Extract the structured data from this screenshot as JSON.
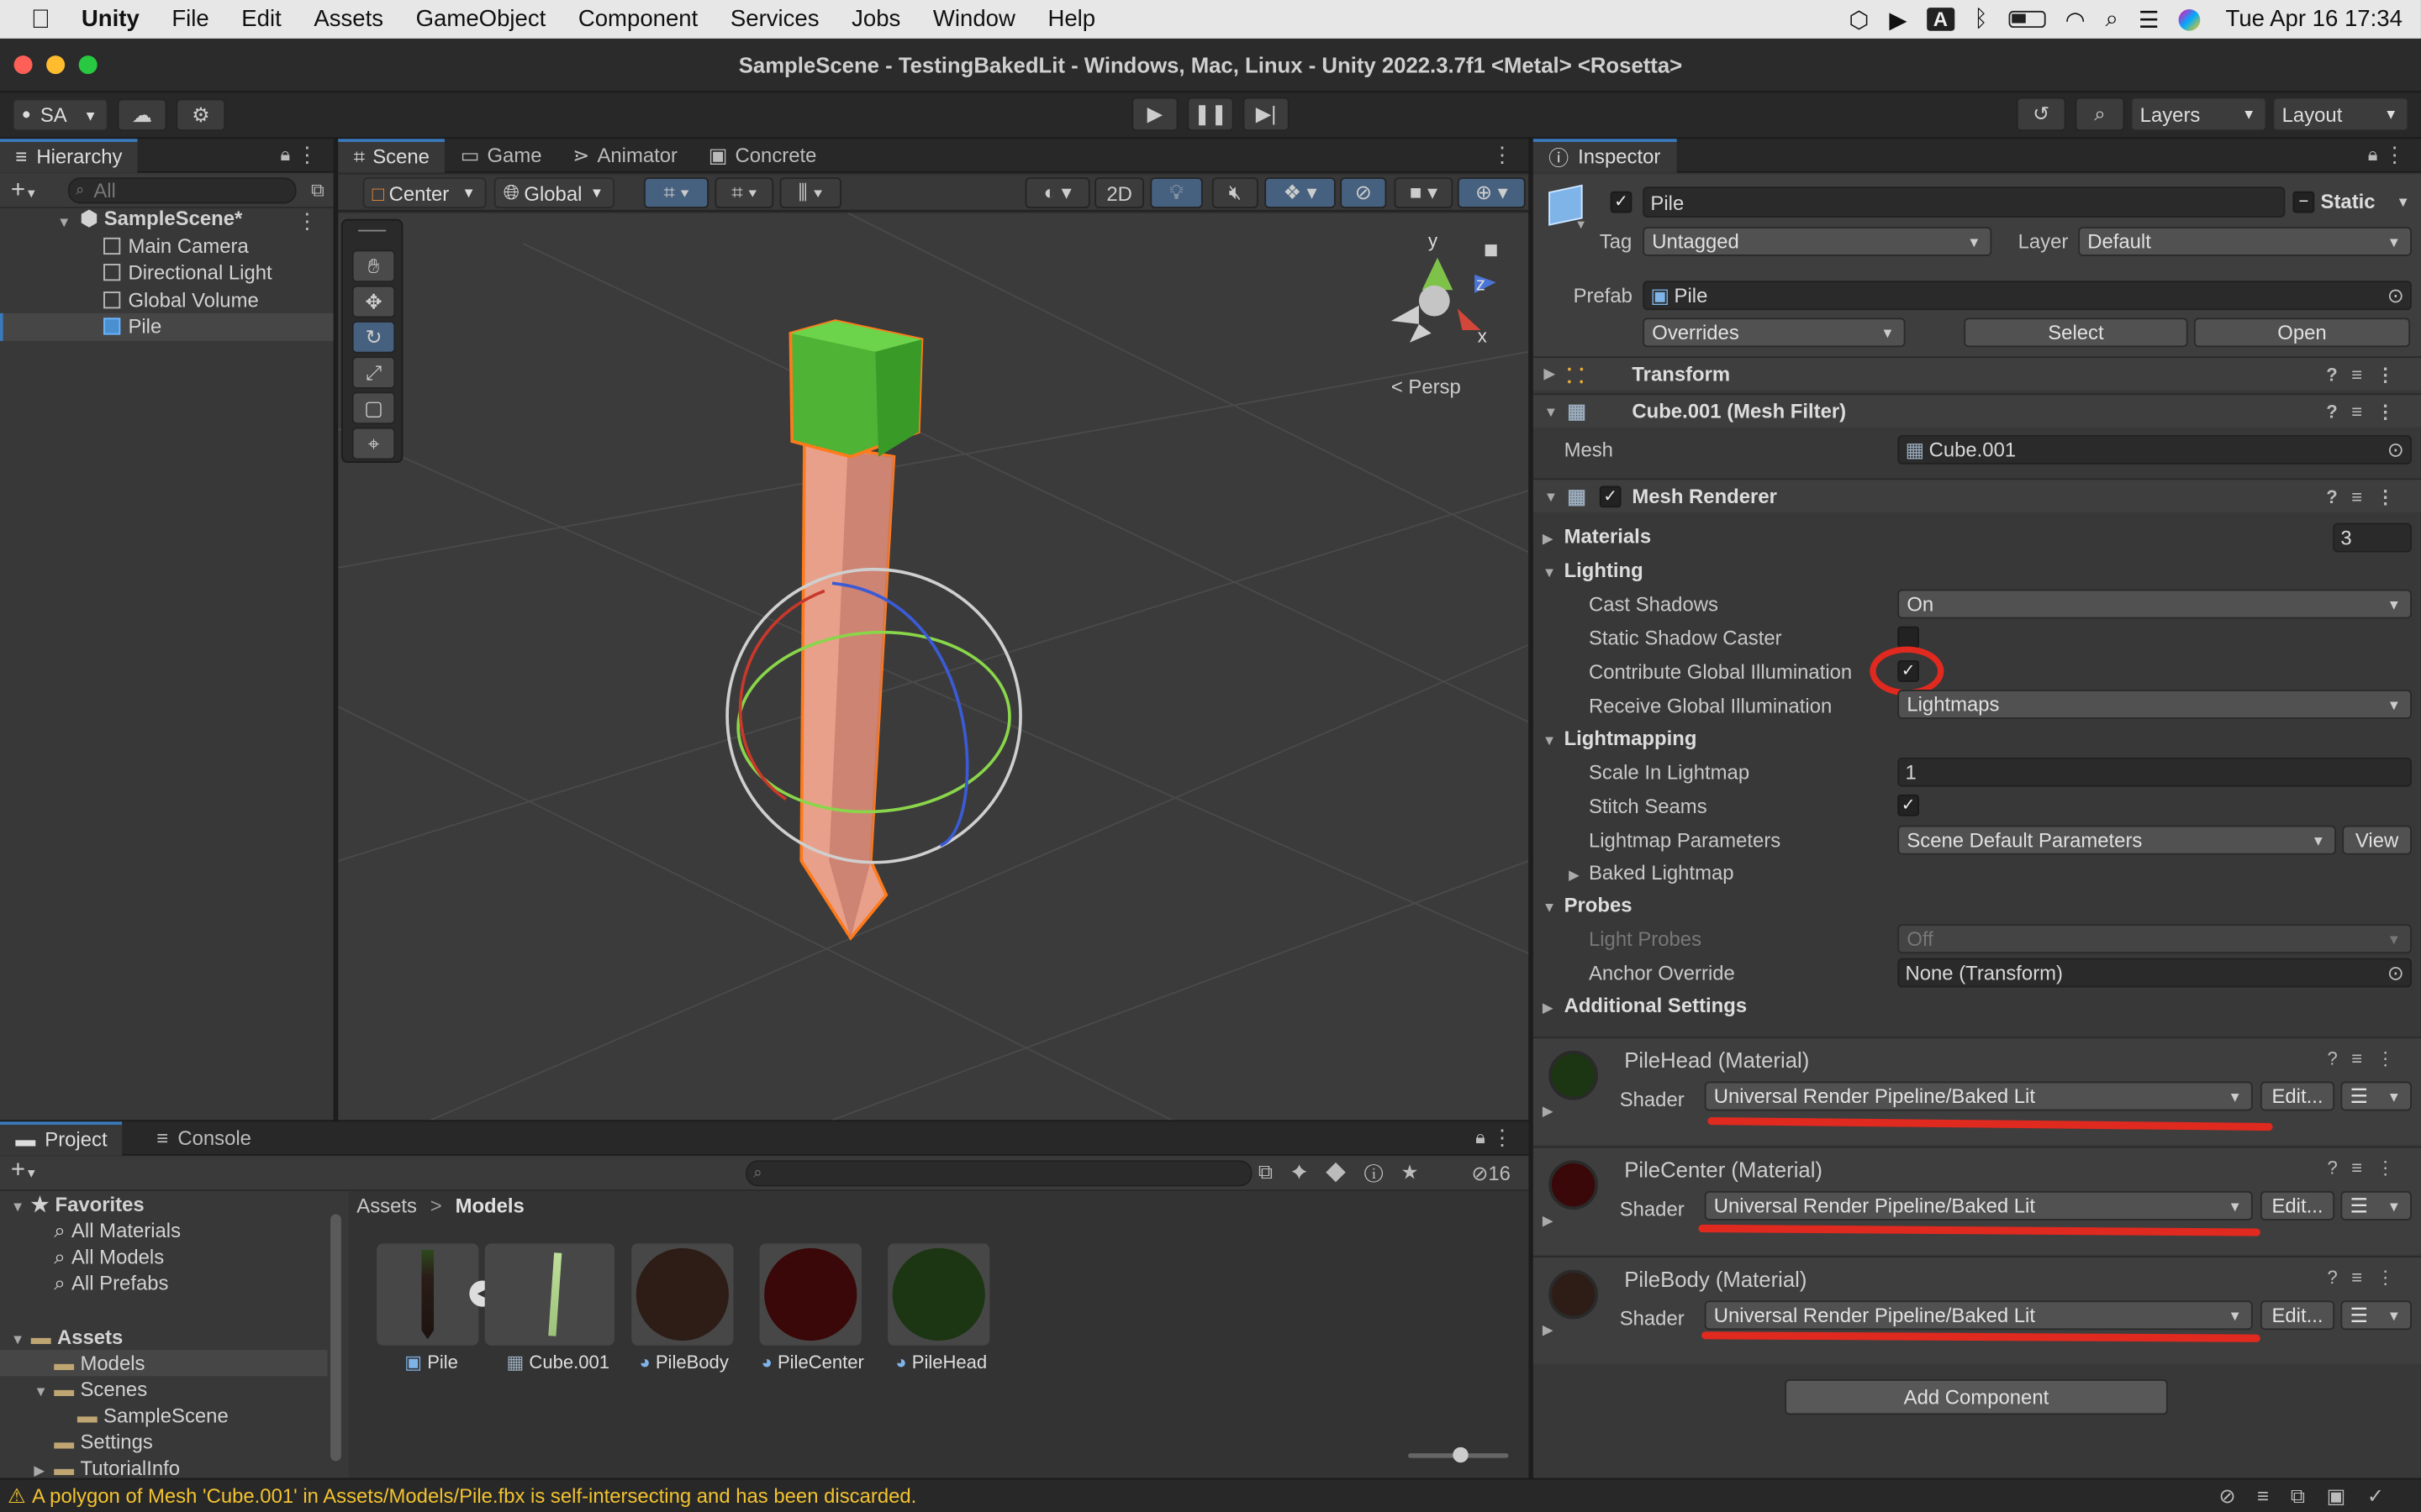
{
  "menubar": {
    "app": "Unity",
    "items": [
      "File",
      "Edit",
      "Assets",
      "GameObject",
      "Component",
      "Services",
      "Jobs",
      "Window",
      "Help"
    ],
    "input_indicator": "A",
    "datetime": "Tue Apr 16  17:34"
  },
  "window": {
    "title": "SampleScene - TestingBakedLit - Windows, Mac, Linux - Unity 2022.3.7f1 <Metal> <Rosetta>"
  },
  "toolbar": {
    "account": "SA",
    "layers": "Layers",
    "layout": "Layout"
  },
  "hierarchy": {
    "tab": "Hierarchy",
    "search_placeholder": "All",
    "scene": "SampleScene*",
    "items": [
      "Main Camera",
      "Directional Light",
      "Global Volume",
      "Pile"
    ]
  },
  "scene_view": {
    "tabs": [
      "Scene",
      "Game",
      "Animator",
      "Concrete"
    ],
    "pivot": "Center",
    "space": "Global",
    "mode_2d": "2D",
    "gizmo_axes": {
      "y": "y",
      "z": "z",
      "x": "x"
    },
    "persp": "Persp"
  },
  "inspector": {
    "tab": "Inspector",
    "name": "Pile",
    "static": "Static",
    "tag_label": "Tag",
    "tag": "Untagged",
    "layer_label": "Layer",
    "layer": "Default",
    "prefab_label": "Prefab",
    "prefab": "Pile",
    "overrides": "Overrides",
    "select": "Select",
    "open": "Open",
    "components": {
      "transform": "Transform",
      "mesh_filter": "Cube.001 (Mesh Filter)",
      "mesh_label": "Mesh",
      "mesh_value": "Cube.001",
      "mesh_renderer": "Mesh Renderer"
    },
    "renderer": {
      "materials_label": "Materials",
      "materials_count": "3",
      "lighting": "Lighting",
      "cast_shadows_label": "Cast Shadows",
      "cast_shadows": "On",
      "static_shadow_caster": "Static Shadow Caster",
      "contribute_gi": "Contribute Global Illumination",
      "receive_gi_label": "Receive Global Illumination",
      "receive_gi": "Lightmaps",
      "lightmapping": "Lightmapping",
      "scale_label": "Scale In Lightmap",
      "scale": "1",
      "stitch_seams": "Stitch Seams",
      "lm_params_label": "Lightmap Parameters",
      "lm_params": "Scene Default Parameters",
      "view": "View",
      "baked_lightmap": "Baked Lightmap",
      "probes": "Probes",
      "light_probes_label": "Light Probes",
      "light_probes": "Off",
      "anchor_label": "Anchor Override",
      "anchor": "None (Transform)",
      "additional": "Additional Settings"
    },
    "materials": [
      {
        "name": "PileHead (Material)",
        "shader_label": "Shader",
        "shader": "Universal Render Pipeline/Baked Lit",
        "edit": "Edit...",
        "color": "#1c3512"
      },
      {
        "name": "PileCenter (Material)",
        "shader_label": "Shader",
        "shader": "Universal Render Pipeline/Baked Lit",
        "edit": "Edit...",
        "color": "#3a0808"
      },
      {
        "name": "PileBody (Material)",
        "shader_label": "Shader",
        "shader": "Universal Render Pipeline/Baked Lit",
        "edit": "Edit...",
        "color": "#2e1d17"
      }
    ],
    "add_component": "Add Component"
  },
  "project": {
    "tabs": [
      "Project",
      "Console"
    ],
    "hidden_count": "16",
    "favorites": "Favorites",
    "fav_items": [
      "All Materials",
      "All Models",
      "All Prefabs"
    ],
    "assets": "Assets",
    "folders": [
      "Models",
      "Scenes",
      "SampleScene",
      "Settings",
      "TutorialInfo"
    ],
    "breadcrumb": [
      "Assets",
      "Models"
    ],
    "thumbs": [
      {
        "name": "Pile",
        "color": "#474747"
      },
      {
        "name": "Cube.001",
        "color": "#474747"
      },
      {
        "name": "PileBody",
        "color": "#2e1d17"
      },
      {
        "name": "PileCenter",
        "color": "#3a0808"
      },
      {
        "name": "PileHead",
        "color": "#1c3512"
      }
    ]
  },
  "status": {
    "message": "A polygon of Mesh 'Cube.001' in Assets/Models/Pile.fbx is self-intersecting and has been discarded."
  }
}
